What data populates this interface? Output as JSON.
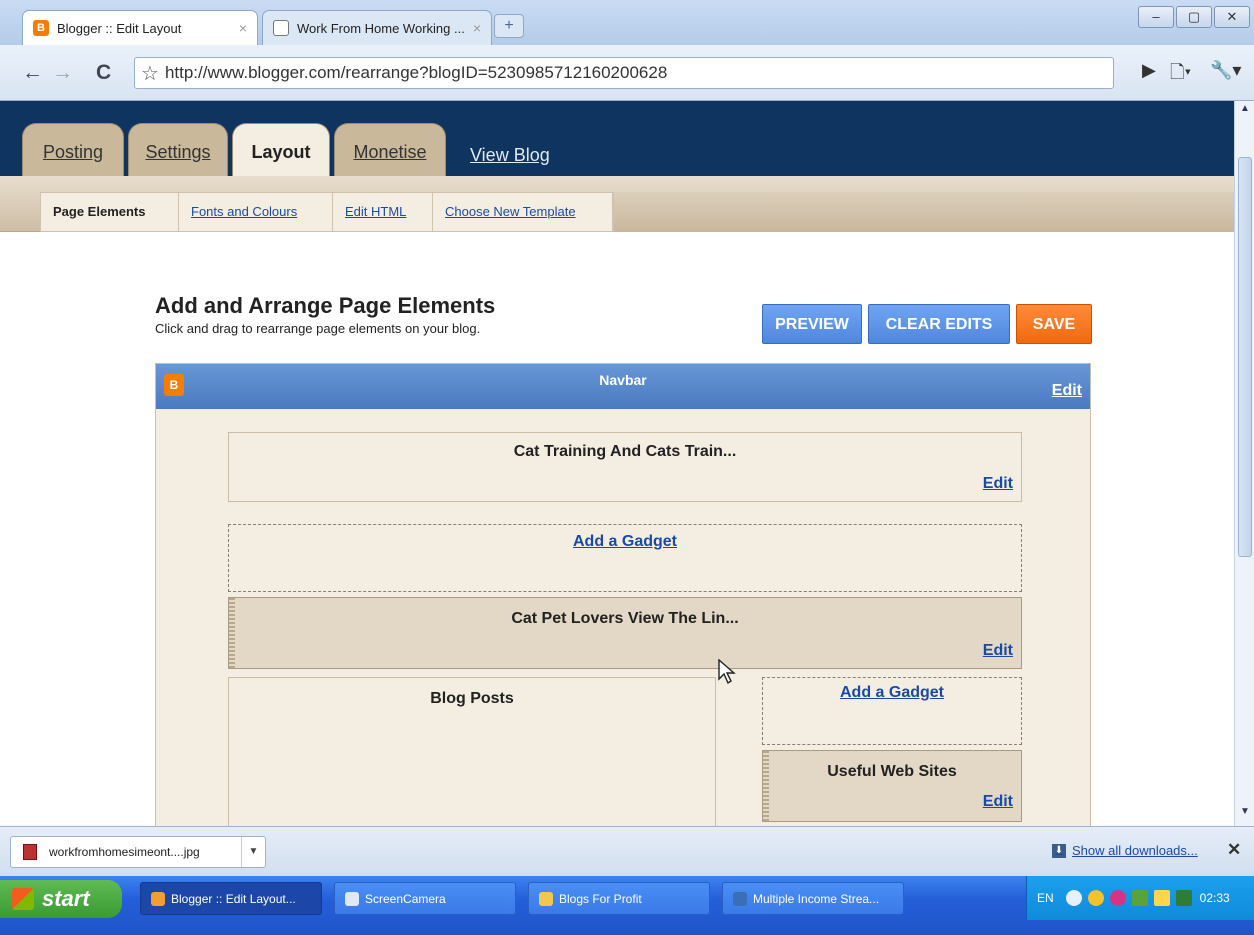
{
  "browser": {
    "tabs": [
      {
        "title": "Blogger :: Edit Layout",
        "favicon": "B"
      },
      {
        "title": "Work From Home Working ...",
        "favicon": ""
      }
    ],
    "new_tab_symbol": "+",
    "window_controls": [
      "–",
      "▢",
      "✕"
    ],
    "nav": {
      "back": "←",
      "forward": "→",
      "reload": "C"
    },
    "url": "http://www.blogger.com/rearrange?blogID=5230985712160200628",
    "toolbar_icons": {
      "play": "▶",
      "page": "🗋▾",
      "wrench": "🔧▾"
    }
  },
  "blogger": {
    "tabs": [
      "Posting",
      "Settings",
      "Layout",
      "Monetise"
    ],
    "active_tab": "Layout",
    "view_blog": "View Blog",
    "subnav": [
      "Page Elements",
      "Fonts and Colours",
      "Edit HTML",
      "Choose New Template"
    ],
    "active_subnav": "Page Elements"
  },
  "page": {
    "heading": "Add and Arrange Page Elements",
    "subheading": "Click and drag to rearrange page elements on your blog.",
    "buttons": {
      "preview": "PREVIEW",
      "clear_edits": "CLEAR EDITS",
      "save": "SAVE"
    },
    "navbar": {
      "logo": "B",
      "title": "Navbar",
      "edit": "Edit"
    },
    "gadgets": {
      "header": {
        "title": "Cat Training And Cats Train...",
        "edit": "Edit"
      },
      "add_gadget_top": "Add a Gadget",
      "cat_pet": {
        "title": "Cat Pet Lovers View The Lin...",
        "edit": "Edit"
      },
      "blog_posts": {
        "title": "Blog Posts"
      },
      "add_gadget_sidebar": "Add a Gadget",
      "useful_sites": {
        "title": "Useful Web Sites",
        "edit": "Edit"
      }
    }
  },
  "downloads": {
    "file": "workfromhomesimeont....jpg",
    "show_all": "Show all downloads...",
    "close": "✕"
  },
  "taskbar": {
    "start": "start",
    "items": [
      {
        "label": "Blogger :: Edit Layout...",
        "active": true,
        "icon_color": "#f0a030"
      },
      {
        "label": "ScreenCamera",
        "active": false,
        "icon_color": "#dfe8f5"
      },
      {
        "label": "Blogs For Profit",
        "active": false,
        "icon_color": "#f2c84b"
      },
      {
        "label": "Multiple Income Strea...",
        "active": false,
        "icon_color": "#3a6fb8"
      }
    ],
    "tray": {
      "language": "EN",
      "clock": "02:33"
    }
  },
  "colors": {
    "blogger_header": "#0f3460",
    "navbar": "#4a79c0",
    "save": "#f06a0e",
    "preview": "#4f87de"
  }
}
